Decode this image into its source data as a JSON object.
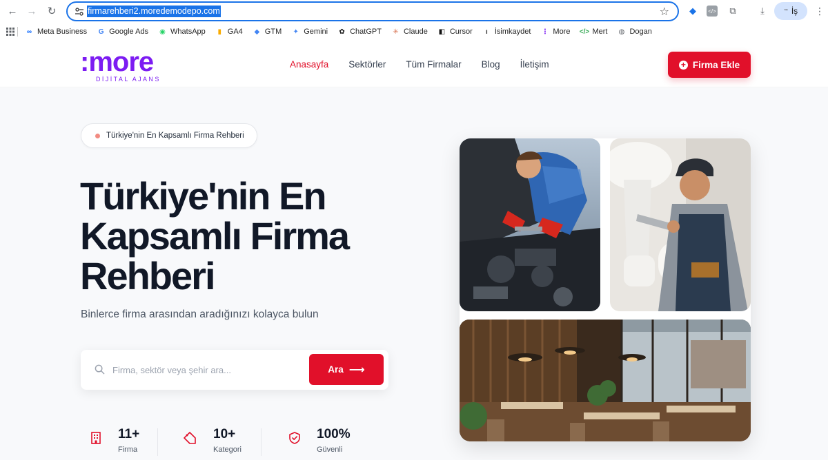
{
  "browser": {
    "url": "firmarehberi2.moredemodepo.com",
    "profile_label": "İş",
    "profile_mini": "™"
  },
  "bookmarks": [
    {
      "label": "Meta Business",
      "icon": "meta-icon",
      "color": "#0866ff",
      "glyph": "∞"
    },
    {
      "label": "Google Ads",
      "icon": "google-icon",
      "color": "#4285f4",
      "glyph": "G"
    },
    {
      "label": "WhatsApp",
      "icon": "whatsapp-icon",
      "color": "#25d366",
      "glyph": "◉"
    },
    {
      "label": "GA4",
      "icon": "analytics-icon",
      "color": "#f9ab00",
      "glyph": "▮"
    },
    {
      "label": "GTM",
      "icon": "gtm-icon",
      "color": "#4285f4",
      "glyph": "◆"
    },
    {
      "label": "Gemini",
      "icon": "gemini-icon",
      "color": "#4285f4",
      "glyph": "✦"
    },
    {
      "label": "ChatGPT",
      "icon": "chatgpt-icon",
      "color": "#111111",
      "glyph": "✿"
    },
    {
      "label": "Claude",
      "icon": "claude-icon",
      "color": "#d97757",
      "glyph": "✳"
    },
    {
      "label": "Cursor",
      "icon": "cursor-icon",
      "color": "#111111",
      "glyph": "◧"
    },
    {
      "label": "İsimkaydet",
      "icon": "isimkaydet-icon",
      "color": "#333333",
      "glyph": "ı"
    },
    {
      "label": "More",
      "icon": "more-icon",
      "color": "#7c1cf2",
      "glyph": "⋮"
    },
    {
      "label": "Mert",
      "icon": "code-icon",
      "color": "#34a853",
      "glyph": "</>"
    },
    {
      "label": "Dogan",
      "icon": "globe-icon",
      "color": "#5f6368",
      "glyph": "◍"
    }
  ],
  "site": {
    "logo_main": ":more",
    "logo_sub": "DİJİTAL AJANS",
    "nav": [
      {
        "label": "Anasayfa",
        "active": true
      },
      {
        "label": "Sektörler",
        "active": false
      },
      {
        "label": "Tüm Firmalar",
        "active": false
      },
      {
        "label": "Blog",
        "active": false
      },
      {
        "label": "İletişim",
        "active": false
      }
    ],
    "cta_label": "Firma Ekle",
    "accent": "#e1102a",
    "brand": "#7c1cf2"
  },
  "hero": {
    "badge": "Türkiye'nin En Kapsamlı Firma Rehberi",
    "title": "Türkiye'nin En Kapsamlı Firma Rehberi",
    "subtitle": "Binlerce firma arasından aradığınızı kolayca bulun",
    "search_placeholder": "Firma, sektör veya şehir ara...",
    "search_button": "Ara",
    "stats": [
      {
        "value": "11+",
        "label": "Firma",
        "icon": "building-icon"
      },
      {
        "value": "10+",
        "label": "Kategori",
        "icon": "tag-icon"
      },
      {
        "value": "100%",
        "label": "Güvenli",
        "icon": "shield-check-icon"
      }
    ]
  },
  "photos": [
    {
      "name": "mechanic-photo",
      "subject": "car-mechanic"
    },
    {
      "name": "plumber-photo",
      "subject": "plumber"
    },
    {
      "name": "restaurant-photo",
      "subject": "restaurant-interior"
    }
  ]
}
